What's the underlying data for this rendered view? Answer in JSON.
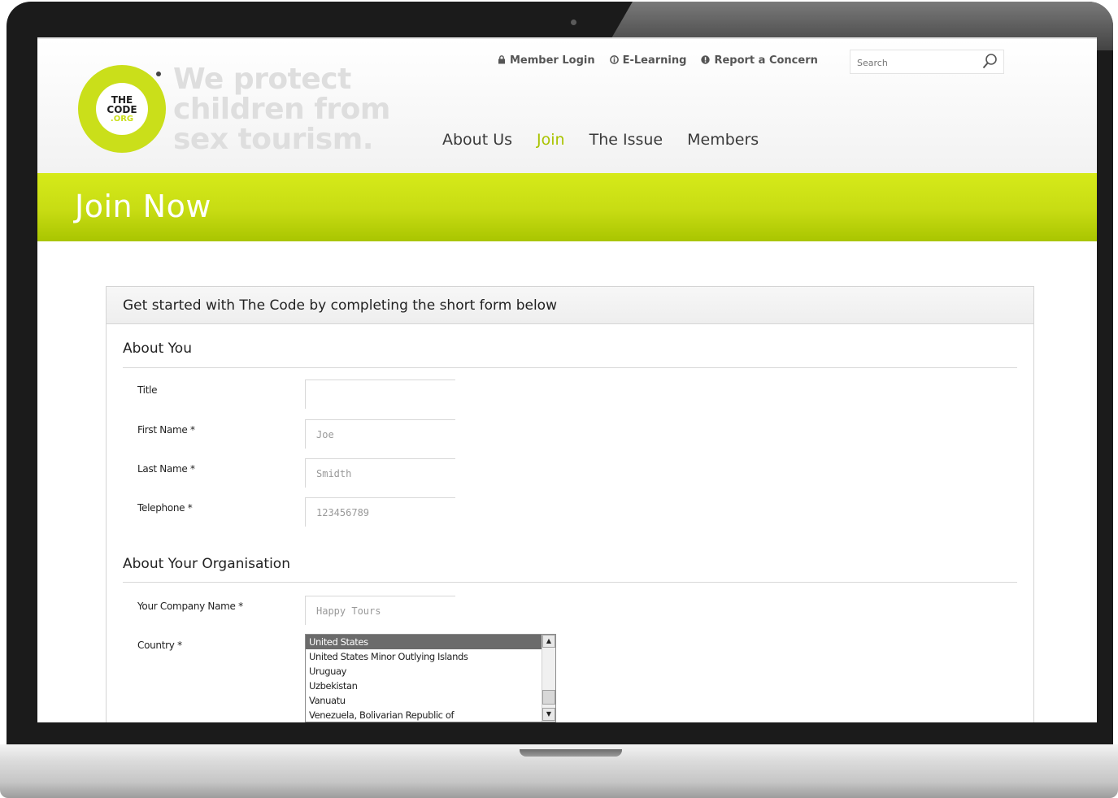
{
  "header": {
    "logo": {
      "line1": "THE",
      "line2": "CODE",
      "line3": ".ORG"
    },
    "tagline": [
      "We protect",
      "children from",
      "sex tourism."
    ],
    "top_links": [
      {
        "icon": "lock-icon",
        "label": "Member Login"
      },
      {
        "icon": "info-icon",
        "label": "E-Learning"
      },
      {
        "icon": "alert-icon",
        "label": "Report a Concern"
      }
    ],
    "search": {
      "placeholder": "Search"
    },
    "nav": [
      {
        "label": "About Us",
        "active": false
      },
      {
        "label": "Join",
        "active": true
      },
      {
        "label": "The Issue",
        "active": false
      },
      {
        "label": "Members",
        "active": false
      }
    ]
  },
  "banner": {
    "title": "Join Now"
  },
  "form": {
    "intro": "Get started with The Code by completing the short form below",
    "about_you": {
      "title": "About You",
      "fields": [
        {
          "label": "Title",
          "value": ""
        },
        {
          "label": "First Name *",
          "value": "Joe"
        },
        {
          "label": "Last Name *",
          "value": "Smidth"
        },
        {
          "label": "Telephone *",
          "value": "123456789"
        }
      ]
    },
    "about_org": {
      "title": "About Your Organisation",
      "company": {
        "label": "Your Company Name *",
        "value": "Happy Tours"
      },
      "country": {
        "label": "Country *",
        "options": [
          "United States",
          "United States Minor Outlying Islands",
          "Uruguay",
          "Uzbekistan",
          "Vanuatu",
          "Venezuela, Bolivarian Republic of"
        ],
        "selected": "United States"
      }
    }
  },
  "colors": {
    "accent": "#cadf1a",
    "nav_active": "#a9c300",
    "band": "#c7dc13"
  }
}
